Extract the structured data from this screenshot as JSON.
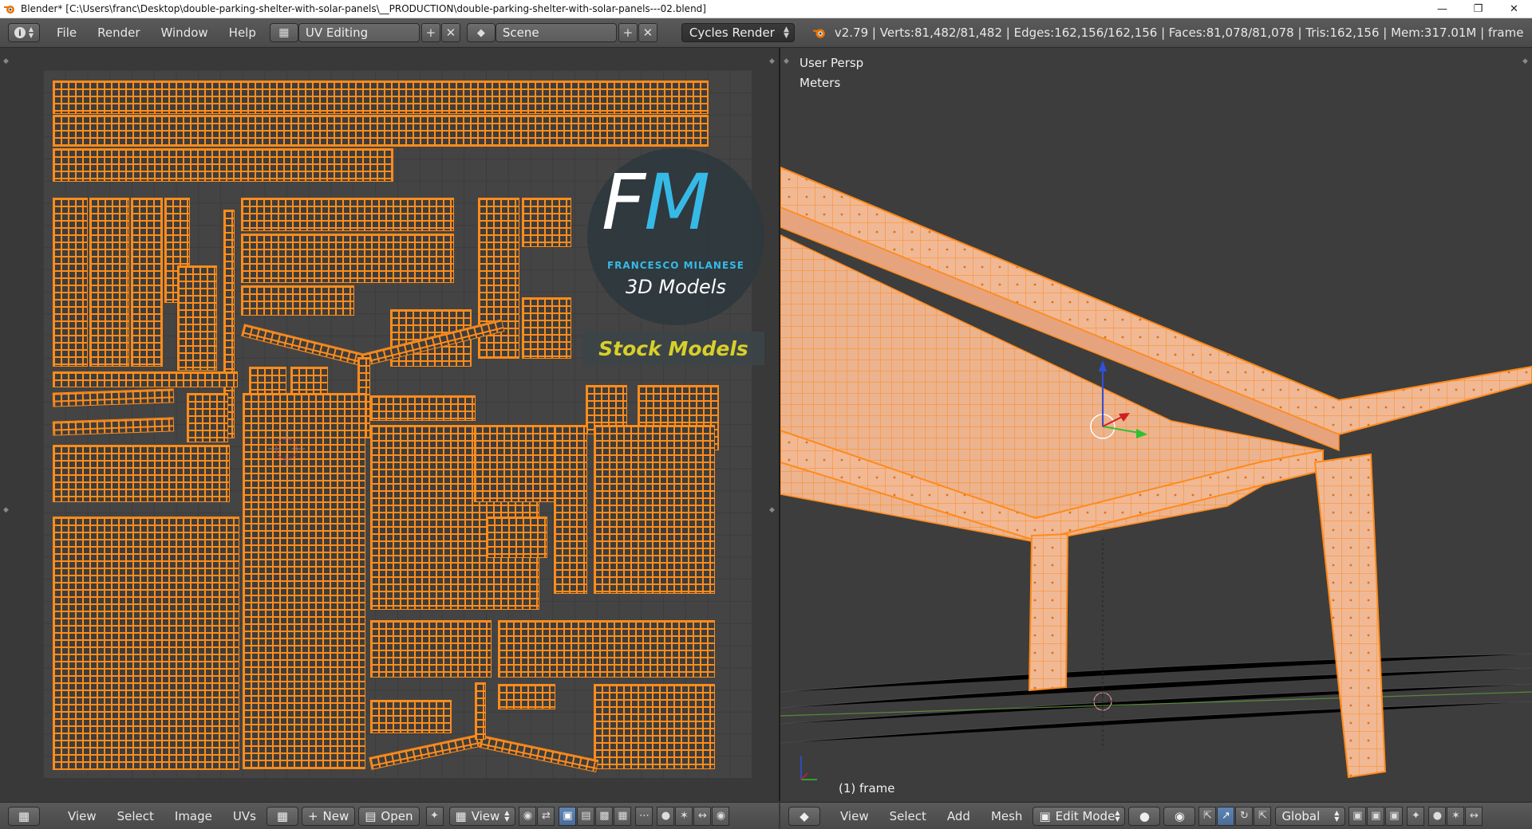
{
  "window": {
    "title": "Blender* [C:\\Users\\franc\\Desktop\\double-parking-shelter-with-solar-panels\\__PRODUCTION\\double-parking-shelter-with-solar-panels---02.blend]",
    "controls": [
      "minimize-icon",
      "restore-icon",
      "close-icon"
    ]
  },
  "infobar": {
    "menus": [
      "File",
      "Render",
      "Window",
      "Help"
    ],
    "screen_layout": "UV Editing",
    "scene": "Scene",
    "render_engine": "Cycles Render",
    "stats": "v2.79 | Verts:81,482/81,482 | Edges:162,156/162,156 | Faces:81,078/81,078 | Tris:162,156 | Mem:317.01M | frame"
  },
  "watermark": {
    "logo_f": "F",
    "logo_m": "M",
    "name": "FRANCESCO MILANESE",
    "subtitle": "3D Models",
    "banner": "Stock Models"
  },
  "viewport": {
    "view_name": "User Persp",
    "units": "Meters",
    "object_label": "(1) frame",
    "colors": {
      "mesh_fill": "#f0b894",
      "wire": "#ff8a1a",
      "background": "#3d3d3d"
    }
  },
  "uv_header": {
    "menus": [
      "View",
      "Select",
      "Image",
      "UVs"
    ],
    "new_label": "New",
    "open_label": "Open",
    "view_label": "View"
  },
  "vp_header": {
    "menus": [
      "View",
      "Select",
      "Add",
      "Mesh"
    ],
    "mode": "Edit Mode",
    "orientation": "Global"
  }
}
